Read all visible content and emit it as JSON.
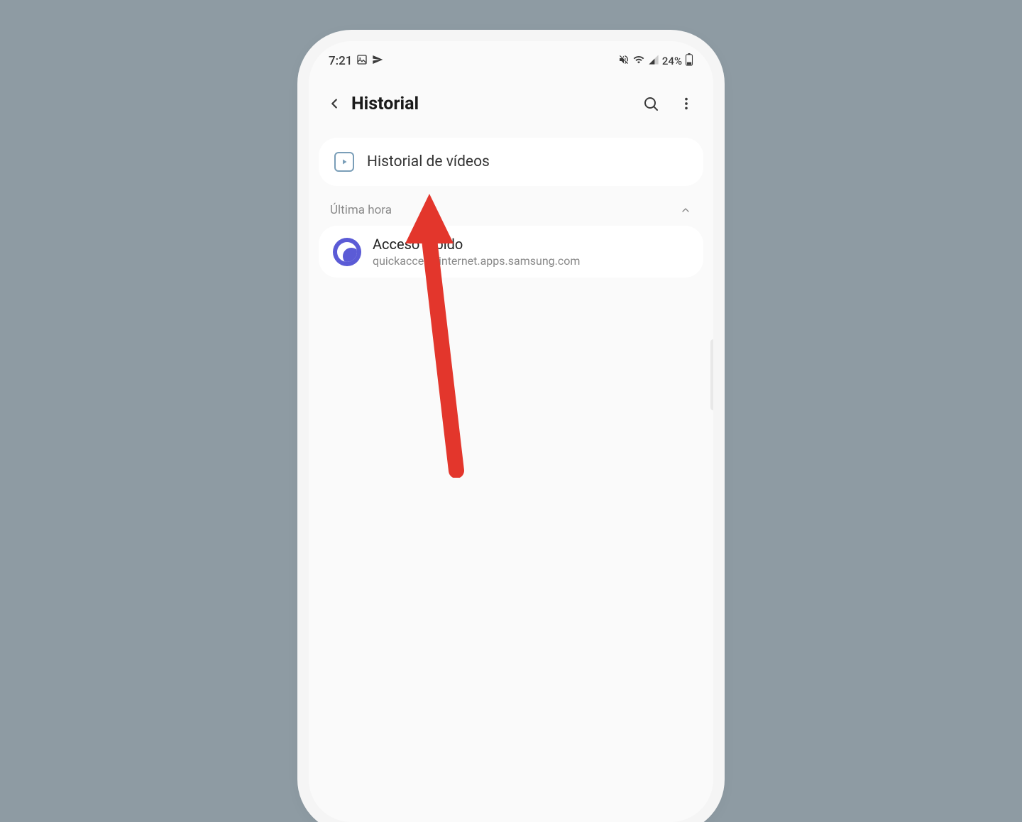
{
  "status": {
    "time": "7:21",
    "battery": "24%"
  },
  "appbar": {
    "title": "Historial"
  },
  "video_history": {
    "label": "Historial de vídeos"
  },
  "section": {
    "label": "Última hora"
  },
  "history_item": {
    "title": "Acceso rápido",
    "url": "quickaccess.internet.apps.samsung.com"
  },
  "colors": {
    "arrow": "#e3362c",
    "accent": "#5b5bd6"
  }
}
